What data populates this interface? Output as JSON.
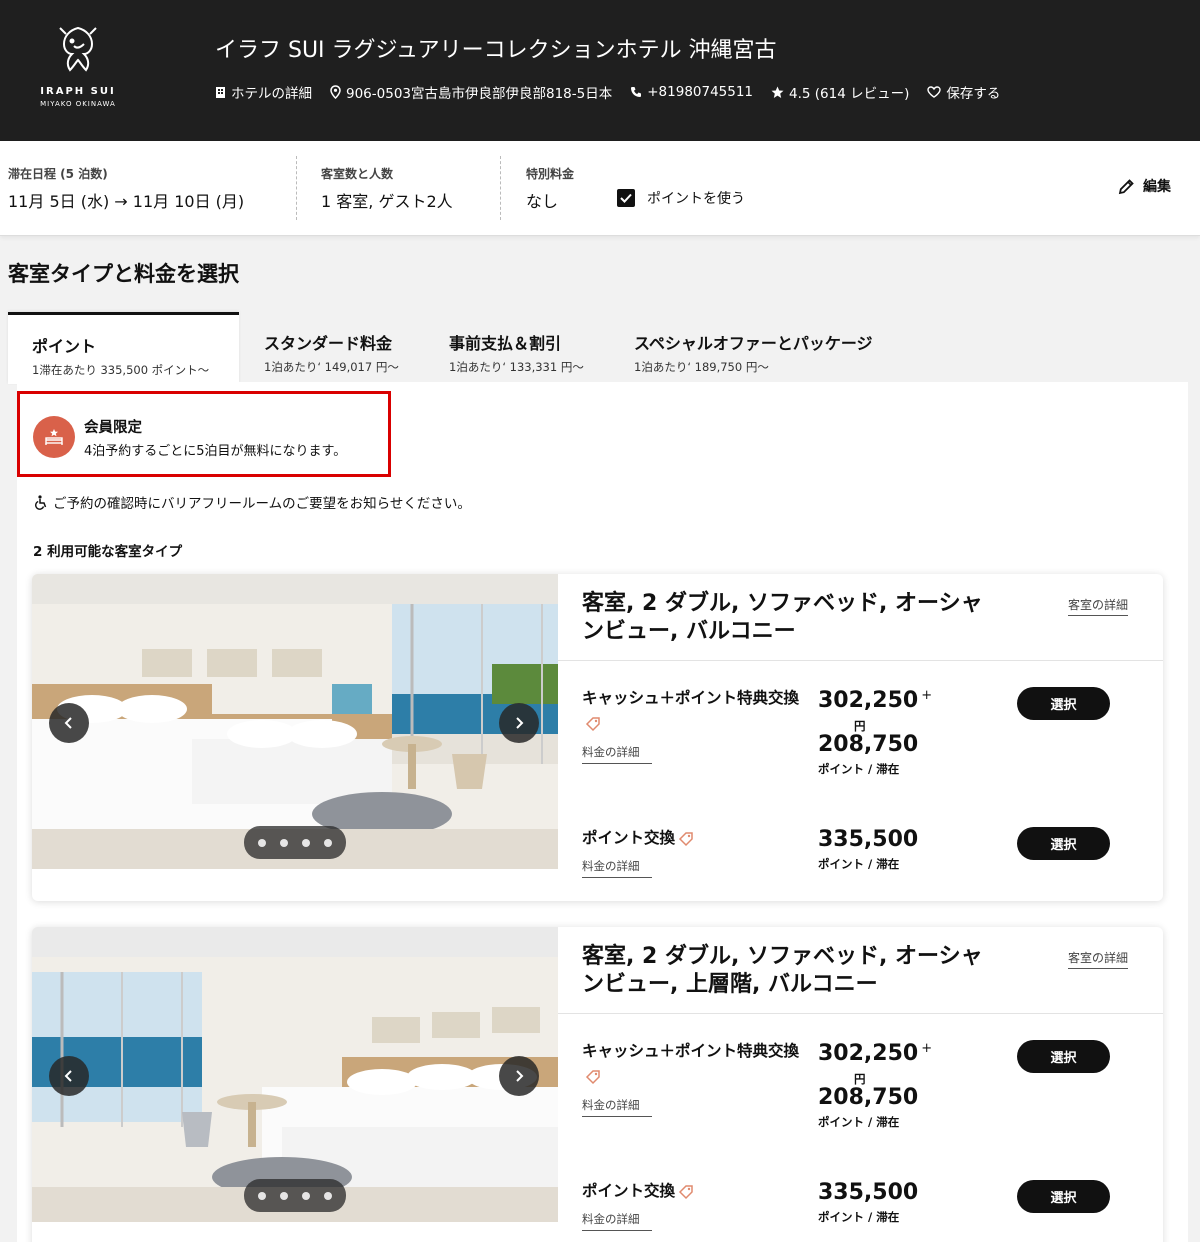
{
  "header": {
    "logo_line1": "IRAPH SUI",
    "logo_line2": "MIYAKO OKINAWA",
    "title": "イラフ SUI ラグジュアリーコレクションホテル 沖縄宮古",
    "hotel_details": "ホテルの詳細",
    "address": "906-0503宮古島市伊良部伊良部818-5日本",
    "phone": "+81980745511",
    "rating": "4.5 (614 レビュー)",
    "save": "保存する"
  },
  "search": {
    "dates_label": "滞在日程 (5 泊数)",
    "dates_value": "11月 5日 (水)  →  11月 10日 (月)",
    "rooms_label": "客室数と人数",
    "rooms_value": "1 客室, ゲスト2人",
    "special_label": "特別料金",
    "special_value": "なし",
    "use_points_label": "ポイントを使う",
    "use_points_checked": true,
    "edit_label": "編集"
  },
  "section_title": "客室タイプと料金を選択",
  "tabs": [
    {
      "title": "ポイント",
      "sub": "1滞在あたり 335,500 ポイント〜",
      "active": true
    },
    {
      "title": "スタンダード料金",
      "sub": "1泊あたり‘ 149,017 円〜",
      "active": false
    },
    {
      "title": "事前支払＆割引",
      "sub": "1泊あたり‘ 133,331 円〜",
      "active": false
    },
    {
      "title": "スペシャルオファーとパッケージ",
      "sub": "1泊あたり‘ 189,750 円〜",
      "active": false
    }
  ],
  "member": {
    "title": "会員限定",
    "text": "4泊予約するごとに5泊目が無料になります。"
  },
  "accessibility_note": "ご予約の確認時にバリアフリールームのご要望をお知らせください。",
  "room_count": "2 利用可能な客室タイプ",
  "rooms": [
    {
      "title": "客室, 2 ダブル, ソファベッド, オーシャンビュー, バルコニー",
      "detail_link": "客室の詳細",
      "rates": [
        {
          "name": "キャッシュ＋ポイント特典交換",
          "link": "料金の詳細",
          "cash": "302,250",
          "plus": "+",
          "cash_unit": "円",
          "points": "208,750",
          "points_unit": "ポイント / 滞在",
          "button": "選択"
        },
        {
          "name": "ポイント交換",
          "link": "料金の詳細",
          "points": "335,500",
          "points_unit": "ポイント / 滞在",
          "button": "選択"
        }
      ]
    },
    {
      "title": "客室, 2 ダブル, ソファベッド, オーシャンビュー, 上層階, バルコニー",
      "detail_link": "客室の詳細",
      "rates": [
        {
          "name": "キャッシュ＋ポイント特典交換",
          "link": "料金の詳細",
          "cash": "302,250",
          "plus": "+",
          "cash_unit": "円",
          "points": "208,750",
          "points_unit": "ポイント / 滞在",
          "button": "選択"
        },
        {
          "name": "ポイント交換",
          "link": "料金の詳細",
          "points": "335,500",
          "points_unit": "ポイント / 滞在",
          "button": "選択"
        }
      ]
    }
  ],
  "colors": {
    "header_bg": "#1f1f1f",
    "member_highlight": "#d90000",
    "member_icon": "#d9614a",
    "tag_icon": "#e08a6e",
    "button_bg": "#111111"
  }
}
